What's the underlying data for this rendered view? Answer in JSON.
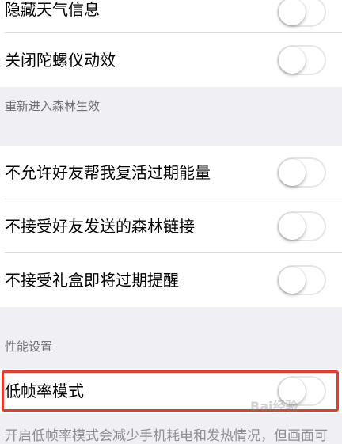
{
  "settings": {
    "rows": [
      {
        "label": "隐藏天气信息",
        "on": false
      },
      {
        "label": "关闭陀螺仪动效",
        "on": false
      }
    ],
    "section_forest": {
      "header": "重新进入森林生效",
      "rows": [
        {
          "label": "不允许好友帮我复活过期能量",
          "on": false
        },
        {
          "label": "不接受好友发送的森林链接",
          "on": false
        },
        {
          "label": "不接受礼盒即将过期提醒",
          "on": false
        }
      ]
    },
    "section_performance": {
      "header": "性能设置",
      "rows": [
        {
          "label": "低帧率模式",
          "on": false
        }
      ],
      "footer": "开启低帧率模式会减少手机耗电和发热情况，但画面可"
    }
  },
  "watermark": {
    "text": "Bai经验"
  },
  "colors": {
    "background": "#f0eff4",
    "cell": "#ffffff",
    "highlight_border": "#e8392f",
    "section_text": "#6d6d72"
  }
}
